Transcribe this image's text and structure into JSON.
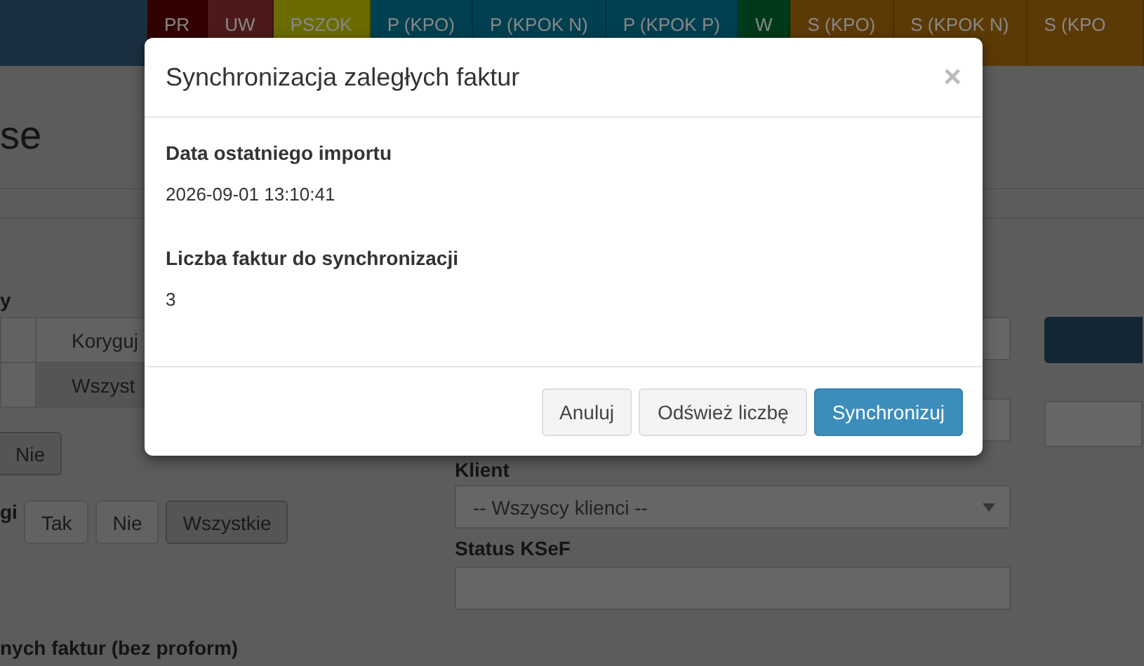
{
  "nav_tabs": [
    {
      "label": "PR",
      "color": "#330000"
    },
    {
      "label": "UW",
      "color": "#4c1a1a"
    },
    {
      "label": "PSZOK",
      "color": "#6b6b00"
    },
    {
      "label": "P (KPO)",
      "color": "#004050"
    },
    {
      "label": "P (KPOK N)",
      "color": "#004050"
    },
    {
      "label": "P (KPOK P)",
      "color": "#004050"
    },
    {
      "label": "W",
      "color": "#003a1a"
    },
    {
      "label": "S (KPO)",
      "color": "#5c3a05"
    },
    {
      "label": "S (KPOK N)",
      "color": "#5c3a05"
    },
    {
      "label": "S (KPO",
      "color": "#5c3a05"
    }
  ],
  "page": {
    "heading": "se",
    "left": {
      "group_label": "y",
      "type_row": [
        {
          "label": "Koryguj",
          "selected": false
        }
      ],
      "scope_row": [
        {
          "label": "Wszyst",
          "selected": true
        }
      ],
      "yes_no": [
        {
          "label": "Nie",
          "selected": true
        }
      ],
      "option_label": "gi",
      "options": [
        {
          "label": "Tak",
          "selected": false
        },
        {
          "label": "Nie",
          "selected": false
        },
        {
          "label": "Wszystkie",
          "selected": true
        }
      ],
      "footer_label": "nych faktur (bez proform)"
    },
    "filters": {
      "client_label": "Klient",
      "client_value": "-- Wszyscy klienci --",
      "status_label": "Status KSeF"
    }
  },
  "modal": {
    "title": "Synchronizacja zaległych faktur",
    "close": "×",
    "fields": [
      {
        "label": "Data ostatniego importu",
        "value": "2026-09-01 13:10:41"
      },
      {
        "label": "Liczba faktur do synchronizacji",
        "value": "3"
      }
    ],
    "buttons": [
      {
        "label": "Anuluj",
        "kind": "default"
      },
      {
        "label": "Odśwież liczbę",
        "kind": "default"
      },
      {
        "label": "Synchronizuj",
        "kind": "primary"
      }
    ]
  }
}
